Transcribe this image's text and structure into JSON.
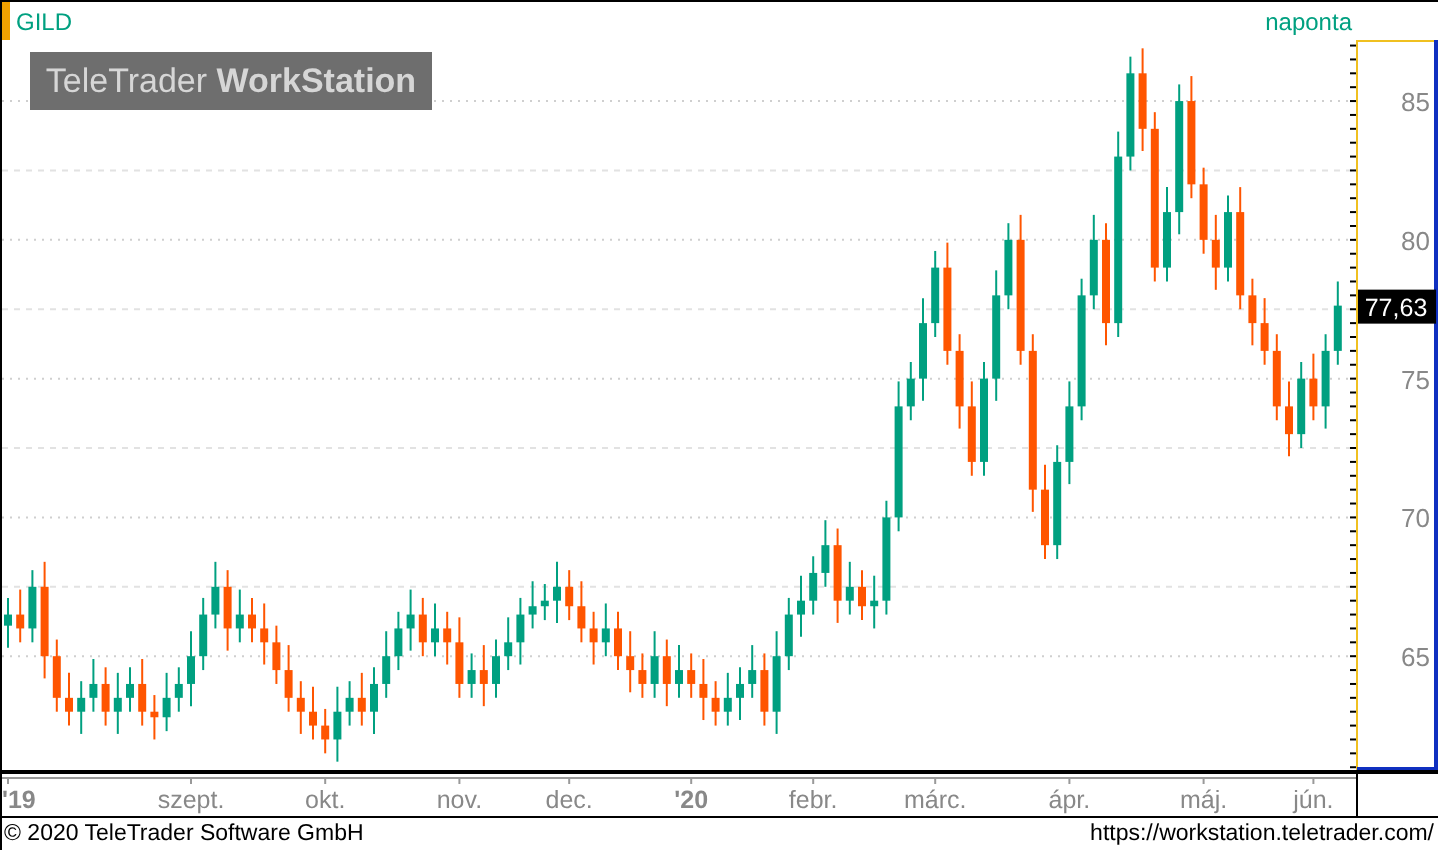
{
  "header": {
    "symbol": "GILD",
    "interval": "naponta"
  },
  "watermark": "TeleTrader **WorkStation**",
  "chart": {
    "last_price": "77,63",
    "chart_data": {
      "type": "candlestick",
      "grid": true,
      "ylim": [
        60.9,
        87.2
      ],
      "yticks": [
        {
          "value": 65,
          "label": "65"
        },
        {
          "value": 70,
          "label": "70"
        },
        {
          "value": 75,
          "label": "75"
        },
        {
          "value": 80,
          "label": "80"
        },
        {
          "value": 85,
          "label": "85"
        }
      ],
      "categories": [
        "'19",
        null,
        null,
        null,
        null,
        null,
        null,
        null,
        null,
        null,
        null,
        null,
        null,
        null,
        null,
        "szept.",
        null,
        null,
        null,
        null,
        null,
        null,
        null,
        null,
        null,
        null,
        "okt.",
        null,
        null,
        null,
        null,
        null,
        null,
        null,
        null,
        null,
        null,
        "nov.",
        null,
        null,
        null,
        null,
        null,
        null,
        null,
        null,
        "dec.",
        null,
        null,
        null,
        null,
        null,
        null,
        null,
        null,
        null,
        "'20",
        null,
        null,
        null,
        null,
        null,
        null,
        null,
        null,
        null,
        "febr.",
        null,
        null,
        null,
        null,
        null,
        null,
        null,
        null,
        null,
        "márc.",
        null,
        null,
        null,
        null,
        null,
        null,
        null,
        null,
        null,
        null,
        "ápr.",
        null,
        null,
        null,
        null,
        null,
        null,
        null,
        null,
        null,
        null,
        "máj.",
        null,
        null,
        null,
        null,
        null,
        null,
        null,
        null,
        "jún.",
        null,
        null
      ],
      "ohlc": [
        [
          66.1,
          67.1,
          65.3,
          66.5
        ],
        [
          66.5,
          67.4,
          65.5,
          66
        ],
        [
          66,
          68.1,
          65.5,
          67.5
        ],
        [
          67.5,
          68.4,
          64.2,
          65
        ],
        [
          65,
          65.6,
          63,
          63.5
        ],
        [
          63.5,
          64.4,
          62.5,
          63
        ],
        [
          63,
          64.1,
          62.2,
          63.5
        ],
        [
          63.5,
          64.9,
          63,
          64
        ],
        [
          64,
          64.6,
          62.5,
          63
        ],
        [
          63,
          64.4,
          62.2,
          63.5
        ],
        [
          63.5,
          64.6,
          63,
          64
        ],
        [
          64,
          64.9,
          62.5,
          63
        ],
        [
          63,
          63.6,
          62,
          62.8
        ],
        [
          62.8,
          64.4,
          62.3,
          63.5
        ],
        [
          63.5,
          64.6,
          63,
          64
        ],
        [
          64,
          65.9,
          63.2,
          65
        ],
        [
          65,
          67.1,
          64.5,
          66.5
        ],
        [
          66.5,
          68.4,
          66,
          67.5
        ],
        [
          67.5,
          68.1,
          65.2,
          66
        ],
        [
          66,
          67.4,
          65.5,
          66.5
        ],
        [
          66.5,
          67.1,
          65.5,
          66
        ],
        [
          66,
          66.9,
          64.7,
          65.5
        ],
        [
          65.5,
          66.1,
          64,
          64.5
        ],
        [
          64.5,
          65.4,
          63,
          63.5
        ],
        [
          63.5,
          64.1,
          62.2,
          63
        ],
        [
          63,
          63.9,
          62,
          62.5
        ],
        [
          62.5,
          63.1,
          61.5,
          62
        ],
        [
          62,
          63.9,
          61.2,
          63
        ],
        [
          63,
          64.1,
          62.5,
          63.5
        ],
        [
          63.5,
          64.4,
          62.5,
          63
        ],
        [
          63,
          64.6,
          62.2,
          64
        ],
        [
          64,
          65.9,
          63.5,
          65
        ],
        [
          65,
          66.6,
          64.5,
          66
        ],
        [
          66,
          67.4,
          65.2,
          66.5
        ],
        [
          66.5,
          67.1,
          65,
          65.5
        ],
        [
          65.5,
          66.9,
          65,
          66
        ],
        [
          66,
          66.6,
          64.7,
          65.5
        ],
        [
          65.5,
          66.4,
          63.5,
          64
        ],
        [
          64,
          65.1,
          63.5,
          64.5
        ],
        [
          64.5,
          65.4,
          63.2,
          64
        ],
        [
          64,
          65.6,
          63.5,
          65
        ],
        [
          65,
          66.4,
          64.5,
          65.5
        ],
        [
          65.5,
          67.1,
          64.7,
          66.5
        ],
        [
          66.5,
          67.7,
          66,
          66.8
        ],
        [
          66.8,
          67.6,
          66.3,
          67
        ],
        [
          67,
          68.4,
          66.2,
          67.5
        ],
        [
          67.5,
          68.1,
          66.3,
          66.8
        ],
        [
          66.8,
          67.7,
          65.5,
          66
        ],
        [
          66,
          66.6,
          64.7,
          65.5
        ],
        [
          65.5,
          66.9,
          65,
          66
        ],
        [
          66,
          66.6,
          64.5,
          65
        ],
        [
          65,
          65.9,
          63.7,
          64.5
        ],
        [
          64.5,
          65.1,
          63.5,
          64
        ],
        [
          64,
          65.9,
          63.5,
          65
        ],
        [
          65,
          65.6,
          63.2,
          64
        ],
        [
          64,
          65.4,
          63.5,
          64.5
        ],
        [
          64.5,
          65.1,
          63.5,
          64
        ],
        [
          64,
          64.9,
          62.7,
          63.5
        ],
        [
          63.5,
          64.1,
          62.5,
          63
        ],
        [
          63,
          64.4,
          62.5,
          63.5
        ],
        [
          63.5,
          64.6,
          62.7,
          64
        ],
        [
          64,
          65.4,
          63.5,
          64.5
        ],
        [
          64.5,
          65.1,
          62.5,
          63
        ],
        [
          63,
          65.9,
          62.2,
          65
        ],
        [
          65,
          67.1,
          64.5,
          66.5
        ],
        [
          66.5,
          67.9,
          65.7,
          67
        ],
        [
          67,
          68.6,
          66.5,
          68
        ],
        [
          68,
          69.9,
          67.5,
          69
        ],
        [
          69,
          69.6,
          66.2,
          67
        ],
        [
          67,
          68.4,
          66.5,
          67.5
        ],
        [
          67.5,
          68.1,
          66.3,
          66.8
        ],
        [
          66.8,
          67.9,
          66,
          67
        ],
        [
          67,
          70.6,
          66.5,
          70
        ],
        [
          70,
          74.9,
          69.5,
          74
        ],
        [
          74,
          75.6,
          73.5,
          75
        ],
        [
          75,
          77.9,
          74.2,
          77
        ],
        [
          77,
          79.6,
          76.5,
          79
        ],
        [
          79,
          79.9,
          75.5,
          76
        ],
        [
          76,
          76.6,
          73.2,
          74
        ],
        [
          74,
          74.9,
          71.5,
          72
        ],
        [
          72,
          75.6,
          71.5,
          75
        ],
        [
          75,
          78.9,
          74.2,
          78
        ],
        [
          78,
          80.6,
          77.5,
          80
        ],
        [
          80,
          80.9,
          75.5,
          76
        ],
        [
          76,
          76.6,
          70.2,
          71
        ],
        [
          71,
          71.9,
          68.5,
          69
        ],
        [
          69,
          72.6,
          68.5,
          72
        ],
        [
          72,
          74.9,
          71.2,
          74
        ],
        [
          74,
          78.6,
          73.5,
          78
        ],
        [
          78,
          80.9,
          77.5,
          80
        ],
        [
          80,
          80.6,
          76.2,
          77
        ],
        [
          77,
          83.9,
          76.5,
          83
        ],
        [
          83,
          86.6,
          82.5,
          86
        ],
        [
          86,
          86.9,
          83.2,
          84
        ],
        [
          84,
          84.6,
          78.5,
          79
        ],
        [
          79,
          81.9,
          78.5,
          81
        ],
        [
          81,
          85.6,
          80.2,
          85
        ],
        [
          85,
          85.9,
          81.5,
          82
        ],
        [
          82,
          82.6,
          79.5,
          80
        ],
        [
          80,
          80.9,
          78.2,
          79
        ],
        [
          79,
          81.6,
          78.5,
          81
        ],
        [
          81,
          81.9,
          77.5,
          78
        ],
        [
          78,
          78.6,
          76.2,
          77
        ],
        [
          77,
          77.9,
          75.5,
          76
        ],
        [
          76,
          76.6,
          73.5,
          74
        ],
        [
          74,
          74.9,
          72.2,
          73
        ],
        [
          73,
          75.6,
          72.5,
          75
        ],
        [
          75,
          75.9,
          73.5,
          74
        ],
        [
          74,
          76.6,
          73.2,
          76
        ],
        [
          76,
          78.5,
          75.5,
          77.63
        ]
      ]
    }
  },
  "footer": {
    "copyright": "© 2020 TeleTrader Software GmbH",
    "url": "https://workstation.teletrader.com/"
  }
}
